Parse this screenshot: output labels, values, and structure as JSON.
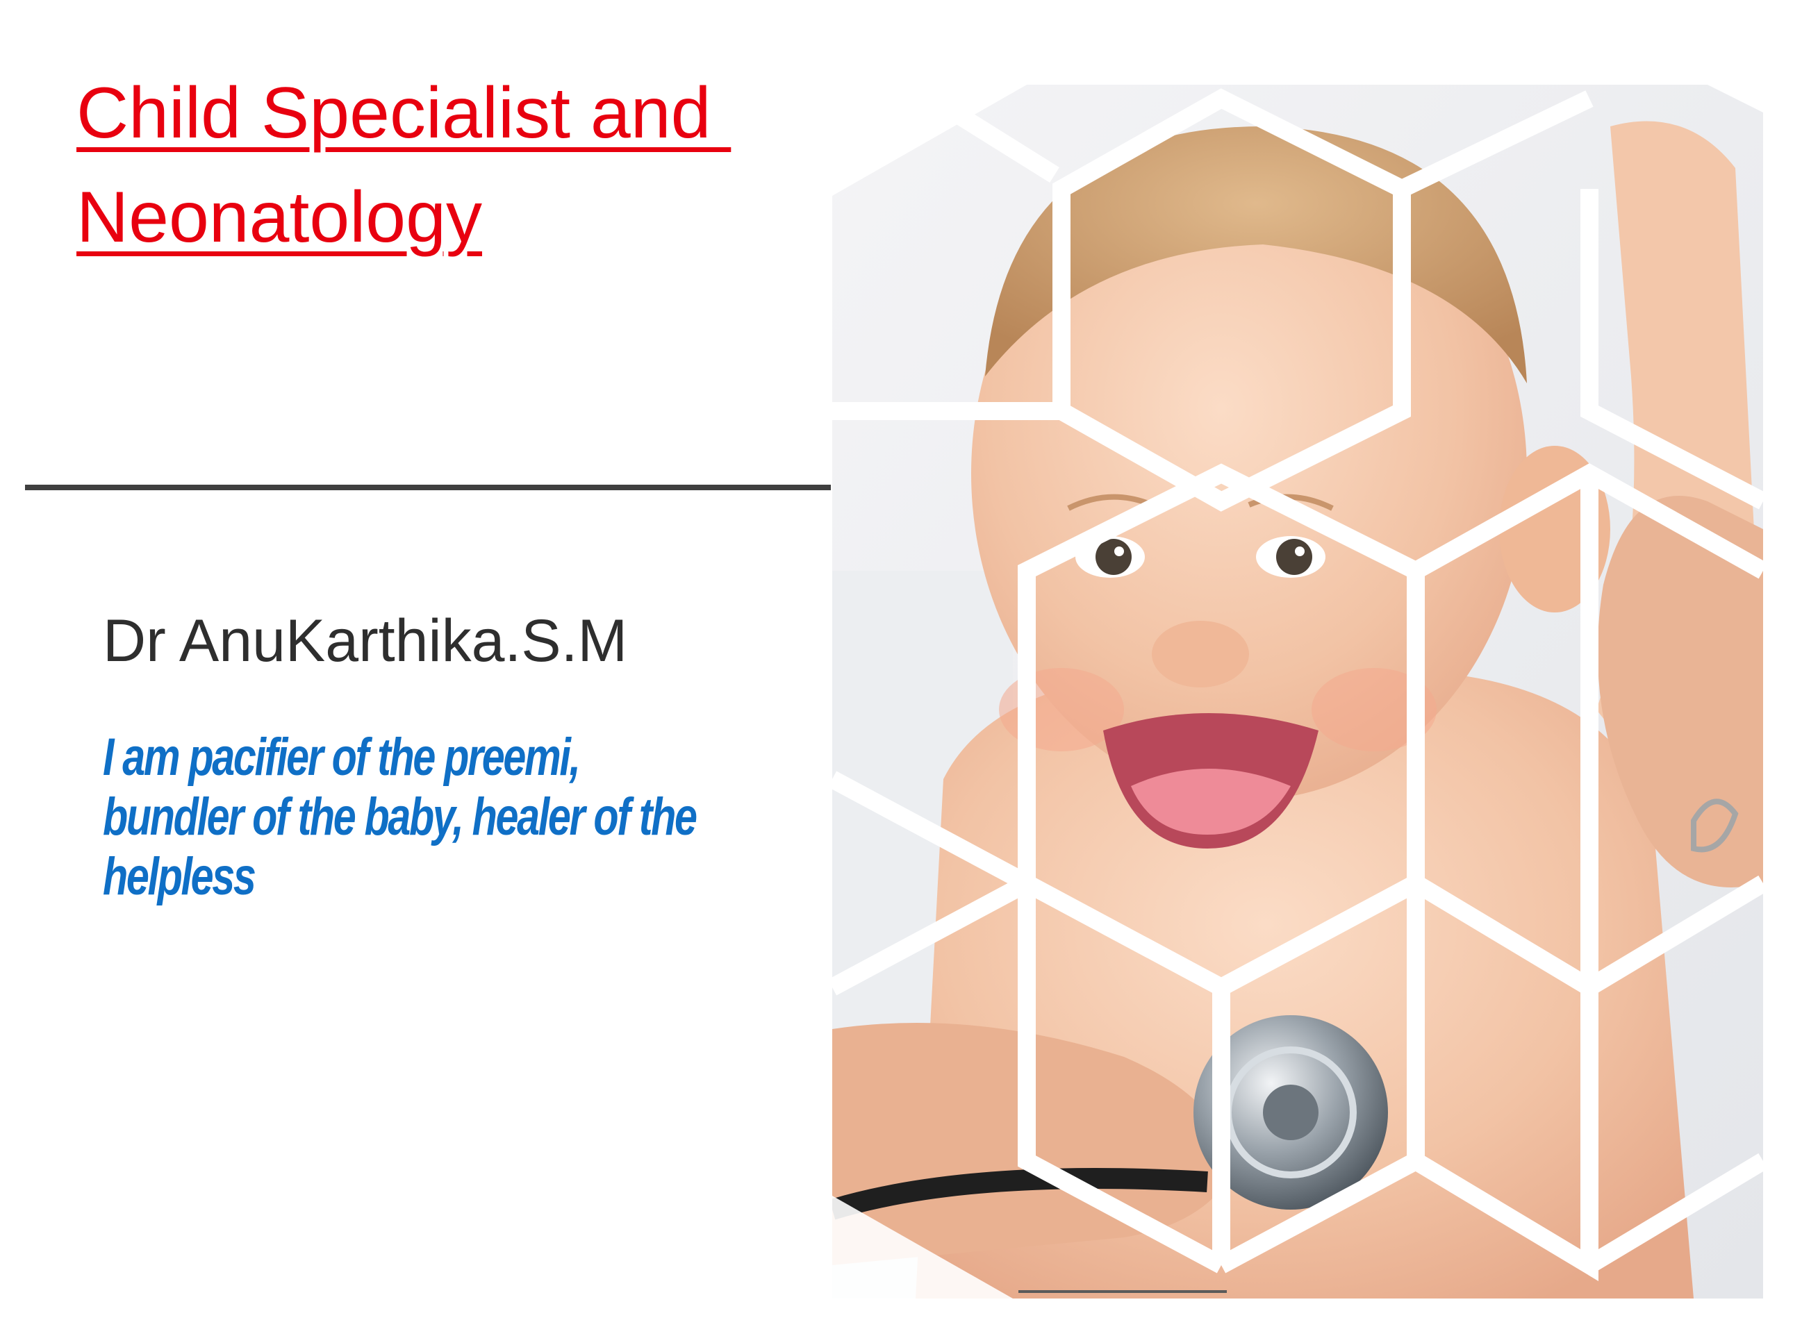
{
  "slide": {
    "title_lines": [
      "Child Specialist and ",
      "Neonatology"
    ],
    "doctor_name": "Dr AnuKarthika.S.M",
    "tagline": "I am pacifier of the preemi, bundler of the baby, healer of the helpless"
  },
  "photo": {
    "subject": "baby-with-stethoscope-hexagon-collage"
  },
  "colors": {
    "title": "#e8000f",
    "name": "#2e2e2e",
    "tagline": "#0f6fc6",
    "divider": "#3f3f3f",
    "skin": "#f3c9ad",
    "hair": "#c99a6a",
    "background": "#ffffff"
  }
}
